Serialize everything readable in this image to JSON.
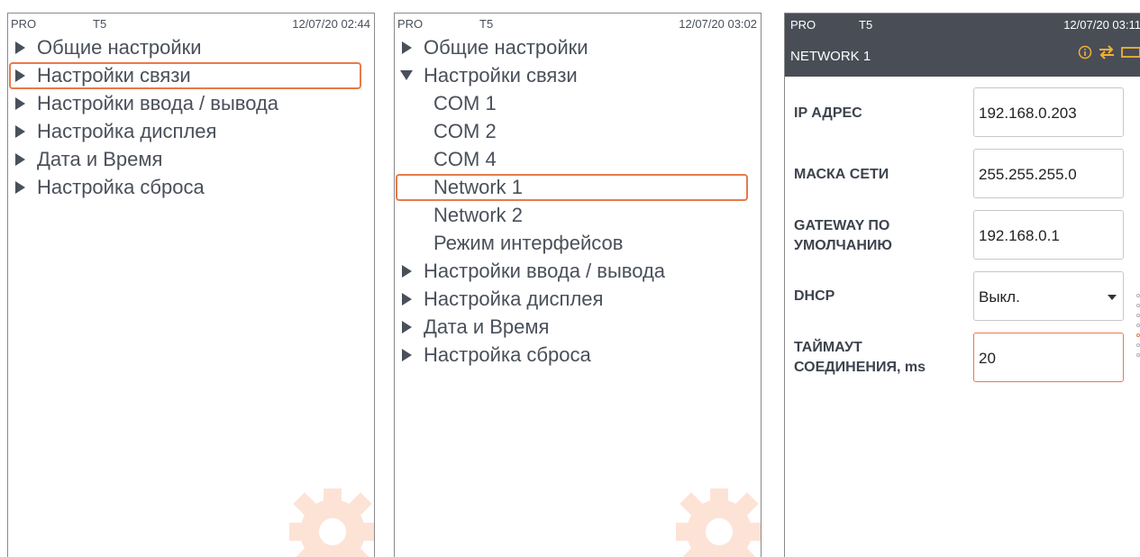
{
  "panel1": {
    "status": {
      "left": "PRO",
      "mid": "T5",
      "right": "12/07/20 02:44"
    },
    "items": [
      {
        "label": "Общие настройки"
      },
      {
        "label": "Настройки связи"
      },
      {
        "label": "Настройки ввода / вывода"
      },
      {
        "label": "Настройка дисплея"
      },
      {
        "label": "Дата и Время"
      },
      {
        "label": "Настройка сброса"
      }
    ]
  },
  "panel2": {
    "status": {
      "left": "PRO",
      "mid": "T5",
      "right": "12/07/20 03:02"
    },
    "items": [
      {
        "label": "Общие настройки"
      },
      {
        "label": "Настройки связи"
      },
      {
        "label": "COM 1"
      },
      {
        "label": "COM 2"
      },
      {
        "label": "COM 4"
      },
      {
        "label": "Network 1"
      },
      {
        "label": "Network 2"
      },
      {
        "label": "Режим интерфейсов"
      },
      {
        "label": "Настройки ввода / вывода"
      },
      {
        "label": "Настройка дисплея"
      },
      {
        "label": "Дата и Время"
      },
      {
        "label": "Настройка сброса"
      }
    ]
  },
  "panel3": {
    "status": {
      "left": "PRO",
      "mid": "T5",
      "right": "12/07/20 03:11"
    },
    "title": "NETWORK 1",
    "icons": [
      "info-icon",
      "transfer-arrows-icon",
      "battery-icon"
    ],
    "fields": {
      "ip": {
        "label": "IP АДРЕС",
        "value": "192.168.0.203"
      },
      "mask": {
        "label": "МАСКА СЕТИ",
        "value": "255.255.255.0"
      },
      "gateway": {
        "label_line1": "GATEWAY ПО",
        "label_line2": "УМОЛЧАНИЮ",
        "value": "192.168.0.1"
      },
      "dhcp": {
        "label": "DHCP",
        "value": "Выкл."
      },
      "timeout": {
        "label_line1": "ТАЙМАУТ",
        "label_line2": "СОЕДИНЕНИЯ, ms",
        "value": "20"
      }
    }
  },
  "colors": {
    "accent": "#e87a4a",
    "header_bg": "#494d56",
    "text": "#4a505a",
    "gear_watermark": "#fde3d6"
  }
}
